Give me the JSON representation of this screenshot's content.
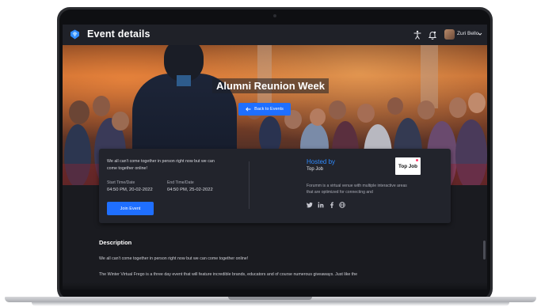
{
  "header": {
    "title": "Event details",
    "user_name": "Zuri Bello",
    "icons": [
      "accessibility-icon",
      "bell-icon",
      "chevron-down-icon"
    ]
  },
  "hero": {
    "title": "Alumni Reunion Week",
    "back_label": "Back to Events"
  },
  "event_card": {
    "description": "We all can't come together in person right now but we can come together online!",
    "start_label": "Start Time/Date",
    "start_value": "04:50 PM, 20-02-2022",
    "end_label": "End Time/Date",
    "end_value": "04:50 PM, 25-02-2022",
    "join_label": "Join Event",
    "hosted_by_label": "Hosted by",
    "host_name": "Top Job",
    "host_description": "Forumm is a virtual venue with multiple interactive areas that are optimized for connecting and",
    "host_logo_text": "Top Job",
    "social_icons": [
      "twitter-icon",
      "linkedin-icon",
      "facebook-icon",
      "globe-icon"
    ]
  },
  "description": {
    "title": "Description",
    "paragraph_1": "We all can't come together in person right now but we can come together online!",
    "paragraph_2": "The Winter Virtual Frego is a three day event that will feature incredible brands, educators and of course numerous giveaways. Just like the"
  },
  "colors": {
    "accent": "#1f6fff",
    "hosted_by": "#2f8bff",
    "background": "#1a1b20",
    "card": "#22242c"
  }
}
